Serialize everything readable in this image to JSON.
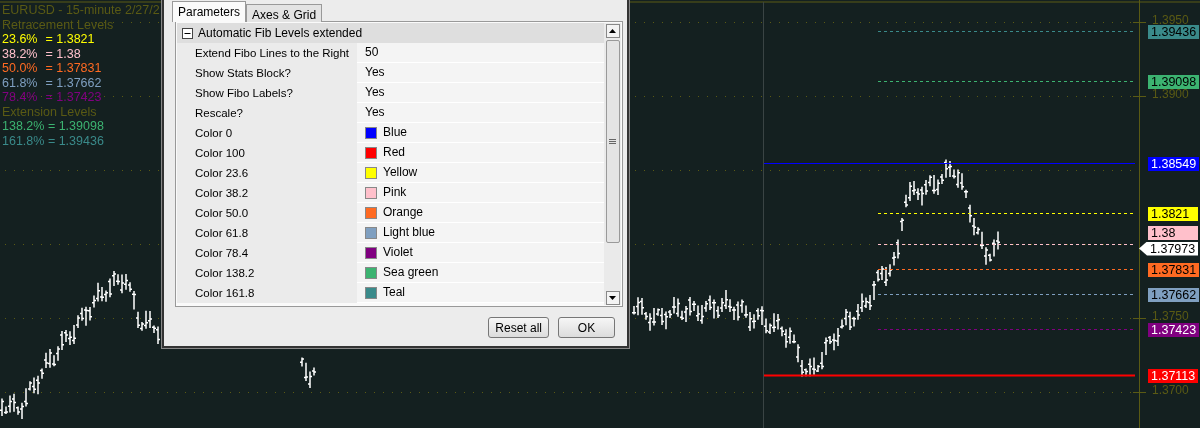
{
  "chart": {
    "title": "EURUSD - 15-minute 2/27/2",
    "retracement_heading": "Retracement Levels",
    "retracement_levels": [
      {
        "label": "23.6%",
        "value": "= 1.3821",
        "color": "#ffff00"
      },
      {
        "label": "38.2%",
        "value": "= 1.38",
        "color": "#ffc0cb"
      },
      {
        "label": "50.0%",
        "value": "= 1.37831",
        "color": "#ff6a22"
      },
      {
        "label": "61.8%",
        "value": "= 1.37662",
        "color": "#7f9fc0"
      },
      {
        "label": "78.4%",
        "value": "= 1.37423",
        "color": "#800080"
      }
    ],
    "extension_heading": "Extension Levels",
    "extension_levels": [
      {
        "label": "138.2%",
        "value": "= 1.39098",
        "color": "#3cb371"
      },
      {
        "label": "161.8%",
        "value": "= 1.39436",
        "color": "#3a8a8a"
      }
    ],
    "price_axis": [
      "1.3950",
      "1.3900",
      "1.3750",
      "1.3700"
    ],
    "price_tags": [
      {
        "text": "1.39436",
        "color": "#3a8a8a",
        "kind": "dashed"
      },
      {
        "text": "1.39098",
        "color": "#3cb371",
        "kind": "dashed"
      },
      {
        "text": "1.38549",
        "color": "#0000ff",
        "kind": "solid"
      },
      {
        "text": "1.3821",
        "color": "#ffff00",
        "kind": "dashed"
      },
      {
        "text": "1.38",
        "color": "#ffc0cb",
        "kind": "dashed"
      },
      {
        "text": "1.37973",
        "color": "#ffffff",
        "kind": "current"
      },
      {
        "text": "1.37831",
        "color": "#ff6a22",
        "kind": "dashed"
      },
      {
        "text": "1.37662",
        "color": "#7f9fc0",
        "kind": "dashed"
      },
      {
        "text": "1.37423",
        "color": "#800080",
        "kind": "dashed"
      },
      {
        "text": "1.37113",
        "color": "#ff0000",
        "kind": "solid"
      }
    ]
  },
  "dialog": {
    "tabs": [
      {
        "label": "Parameters",
        "selected": true
      },
      {
        "label": "Axes & Grid",
        "selected": false
      }
    ],
    "group": {
      "label": "Automatic Fib Levels extended",
      "expanded": true
    },
    "properties": [
      {
        "name": "Extend Fibo Lines to the Right",
        "value": "50",
        "kind": "text"
      },
      {
        "name": "Show Stats Block?",
        "value": "Yes",
        "kind": "text"
      },
      {
        "name": "Show Fibo Labels?",
        "value": "Yes",
        "kind": "text"
      },
      {
        "name": "Rescale?",
        "value": "Yes",
        "kind": "text"
      },
      {
        "name": "Color 0",
        "value": "Blue",
        "kind": "color",
        "color": "#0000ff"
      },
      {
        "name": "Color 100",
        "value": "Red",
        "kind": "color",
        "color": "#ff0000"
      },
      {
        "name": "Color 23.6",
        "value": "Yellow",
        "kind": "color",
        "color": "#ffff00"
      },
      {
        "name": "Color 38.2",
        "value": "Pink",
        "kind": "color",
        "color": "#ffc0cb"
      },
      {
        "name": "Color 50.0",
        "value": "Orange",
        "kind": "color",
        "color": "#ff6a22"
      },
      {
        "name": "Color 61.8",
        "value": "Light blue",
        "kind": "color",
        "color": "#7f9fc0"
      },
      {
        "name": "Color 78.4",
        "value": "Violet",
        "kind": "color",
        "color": "#800080"
      },
      {
        "name": "Color 138.2",
        "value": "Sea green",
        "kind": "color",
        "color": "#3cb371"
      },
      {
        "name": "Color 161.8",
        "value": "Teal",
        "kind": "color",
        "color": "#3a8a8a"
      }
    ],
    "buttons": [
      {
        "label": "Reset all"
      },
      {
        "label": "OK"
      }
    ]
  }
}
